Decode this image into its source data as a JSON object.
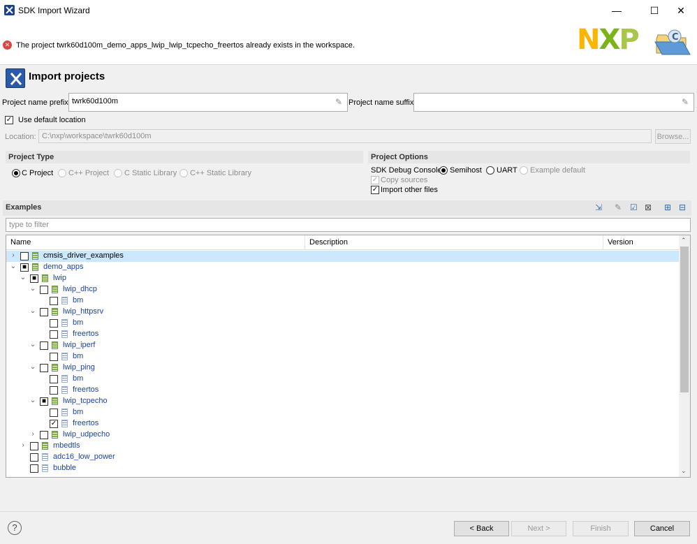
{
  "window": {
    "title": "SDK Import Wizard",
    "minimize": "—",
    "maximize": "☐",
    "close": "✕"
  },
  "banner": {
    "error_message": "The project twrk60d100m_demo_apps_lwip_lwip_tcpecho_freertos already exists in the workspace.",
    "logo_text": "NXP",
    "logo_colors": [
      "#f9b500",
      "#7bb31a",
      "#a8c74a"
    ]
  },
  "page": {
    "title": "Import projects"
  },
  "form": {
    "prefix_label": "Project name prefix:",
    "prefix_value": "twrk60d100m",
    "suffix_label": "Project name suffix:",
    "suffix_value": "",
    "use_default_location": "Use default location",
    "location_label": "Location:",
    "location_value": "C:\\nxp\\workspace\\twrk60d100m",
    "browse": "Browse..."
  },
  "project_type": {
    "header": "Project Type",
    "options": [
      "C Project",
      "C++ Project",
      "C Static Library",
      "C++ Static Library"
    ],
    "selected": "C Project"
  },
  "project_options": {
    "header": "Project Options",
    "debug_console_label": "SDK Debug Console",
    "console_options": [
      "Semihost",
      "UART",
      "Example default"
    ],
    "selected": "Semihost",
    "copy_sources": "Copy sources",
    "import_other_files": "Import other files"
  },
  "examples": {
    "header": "Examples",
    "filter_placeholder": "type to filter",
    "columns": [
      "Name",
      "Description",
      "Version"
    ],
    "rows": [
      {
        "label": "cmsis_driver_examples",
        "level": 0,
        "expander": "›",
        "check": "",
        "icon": "folder"
      },
      {
        "label": "demo_apps",
        "level": 0,
        "expander": "⌄",
        "check": "■",
        "icon": "folder"
      },
      {
        "label": "lwip",
        "level": 1,
        "expander": "⌄",
        "check": "■",
        "icon": "folder"
      },
      {
        "label": "lwip_dhcp",
        "level": 2,
        "expander": "⌄",
        "check": "",
        "icon": "folder"
      },
      {
        "label": "bm",
        "level": 3,
        "expander": "",
        "check": "",
        "icon": "proj"
      },
      {
        "label": "lwip_httpsrv",
        "level": 2,
        "expander": "⌄",
        "check": "",
        "icon": "folder"
      },
      {
        "label": "bm",
        "level": 3,
        "expander": "",
        "check": "",
        "icon": "proj"
      },
      {
        "label": "freertos",
        "level": 3,
        "expander": "",
        "check": "",
        "icon": "proj"
      },
      {
        "label": "lwip_iperf",
        "level": 2,
        "expander": "⌄",
        "check": "",
        "icon": "folder"
      },
      {
        "label": "bm",
        "level": 3,
        "expander": "",
        "check": "",
        "icon": "proj"
      },
      {
        "label": "lwip_ping",
        "level": 2,
        "expander": "⌄",
        "check": "",
        "icon": "folder"
      },
      {
        "label": "bm",
        "level": 3,
        "expander": "",
        "check": "",
        "icon": "proj"
      },
      {
        "label": "freertos",
        "level": 3,
        "expander": "",
        "check": "",
        "icon": "proj"
      },
      {
        "label": "lwip_tcpecho",
        "level": 2,
        "expander": "⌄",
        "check": "■",
        "icon": "folder"
      },
      {
        "label": "bm",
        "level": 3,
        "expander": "",
        "check": "",
        "icon": "proj"
      },
      {
        "label": "freertos",
        "level": 3,
        "expander": "",
        "check": "✓",
        "icon": "proj"
      },
      {
        "label": "lwip_udpecho",
        "level": 2,
        "expander": "›",
        "check": "",
        "icon": "folder"
      },
      {
        "label": "mbedtls",
        "level": 1,
        "expander": "›",
        "check": "",
        "icon": "folder"
      },
      {
        "label": "adc16_low_power",
        "level": 1,
        "expander": "",
        "check": "",
        "icon": "proj"
      },
      {
        "label": "bubble",
        "level": 1,
        "expander": "",
        "check": "",
        "icon": "proj"
      }
    ]
  },
  "footer": {
    "help": "?",
    "back": "< Back",
    "next": "Next >",
    "finish": "Finish",
    "cancel": "Cancel"
  }
}
